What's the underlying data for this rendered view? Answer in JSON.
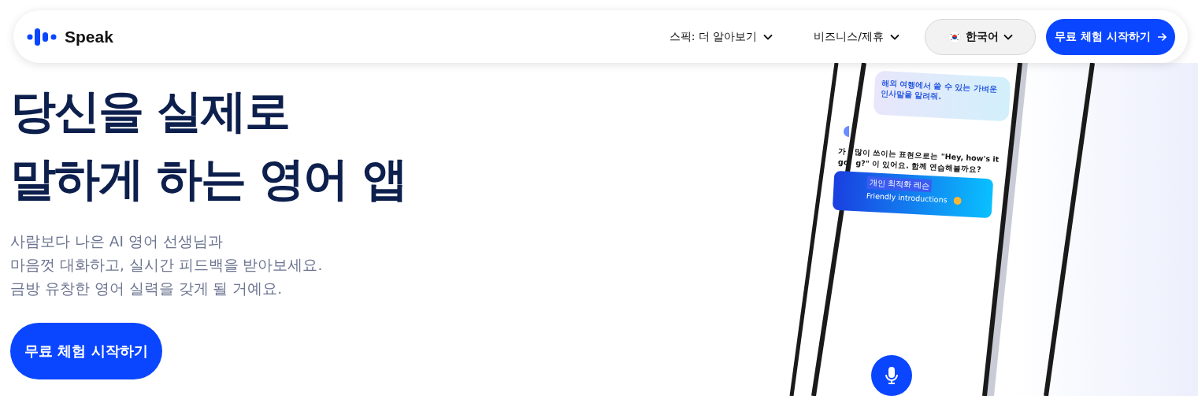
{
  "nav": {
    "logo": "Speak",
    "links": [
      {
        "label": "스픽: 더 알아보기"
      },
      {
        "label": "비즈니스/제휴"
      }
    ],
    "language": "한국어",
    "cta": "무료 체험 시작하기"
  },
  "hero": {
    "title": [
      "당신을 실제로",
      "말하게 하는 영어 앱"
    ],
    "description": "사람보다 나은 AI 영어 선생님과\n마음껏 대화하고, 실시간 피드백을 받아보세요.\n금방 유창한 영어 실력을 갖게 될 거예요.",
    "cta": "무료 체험 시작하기"
  },
  "phone": {
    "user_message": "해외 여행에서 쓸 수 있는 가벼운\n인사말을 알려줘.",
    "reply_lines": [
      [
        "가",
        "많이 쓰이는 표현으로는 \"Hey, how's it"
      ],
      [
        "go",
        "g?\" 이 있어요. 함께 연습해볼까요?"
      ]
    ],
    "lesson": {
      "tag": "개인 최적화 레슨",
      "title": "Friendly introductions"
    }
  }
}
